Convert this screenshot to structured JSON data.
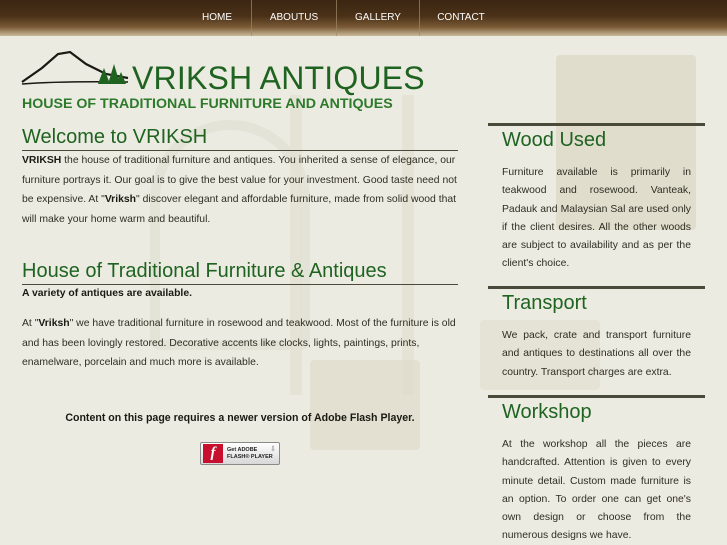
{
  "nav": {
    "items": [
      "HOME",
      "ABOUTUS",
      "GALLERY",
      "CONTACT"
    ]
  },
  "header": {
    "title": "VRIKSH ANTIQUES",
    "tagline": "HOUSE OF TRADITIONAL FURNITURE AND ANTIQUES"
  },
  "welcome": {
    "title": "Welcome to VRIKSH",
    "brand": "VRIKSH",
    "p1": " the house of traditional furniture and antiques. You inherited a sense of elegance, our furniture portrays it. Our goal is to give the best value for your investment. Good taste need not be expensive. At \"",
    "brand2": "Vriksh",
    "p2": "\" discover elegant and affordable furniture, made from solid wood that will make your home warm and beautiful."
  },
  "house": {
    "title": "House of Traditional Furniture & Antiques",
    "subtitle": "A variety of antiques are available.",
    "p1": "At \"",
    "brand": "Vriksh",
    "p2": "\" we have traditional furniture in rosewood and teakwood. Most of the furniture is old and has been lovingly restored. Decorative accents like clocks, lights, paintings, prints, enamelware, porcelain and much more is available."
  },
  "flash": {
    "message": "Content on this page requires a newer version of Adobe Flash Player.",
    "badge_line1": "Get ADOBE",
    "badge_line2": "FLASH® PLAYER"
  },
  "sidebar": {
    "wood": {
      "title": "Wood Used",
      "text": "Furniture available is primarily in teakwood and rosewood. Vanteak, Padauk and Malaysian Sal are used only if the client desires. All the other woods are subject to availability and as per the client's choice."
    },
    "transport": {
      "title": "Transport",
      "text": "We pack, crate and transport furniture and antiques to destinations all over the country. Transport charges are extra."
    },
    "workshop": {
      "title": "Workshop",
      "text": "At the workshop all the pieces are handcrafted. Attention is given to every minute detail. Custom made furniture is an option. To order one can get one's own design or choose from the numerous designs we have."
    }
  },
  "colors": {
    "heading_green": "#1f6321",
    "nav_brown": "#3b2612",
    "background": "#ecebe2"
  }
}
